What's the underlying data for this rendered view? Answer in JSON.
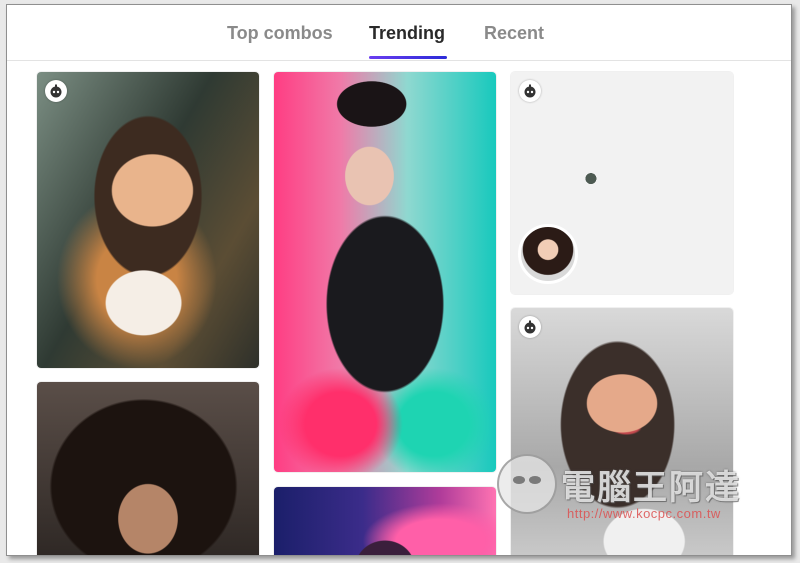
{
  "tabs": [
    {
      "label": "Top combos",
      "active": false
    },
    {
      "label": "Trending",
      "active": true
    },
    {
      "label": "Recent",
      "active": false
    }
  ],
  "accent_colors": {
    "tab_underline_start": "#6a3df0",
    "tab_underline_end": "#2b2bd8"
  },
  "gallery": {
    "cards": [
      {
        "style": "painted-portrait-woman",
        "badge_icon": "combo-face-icon",
        "has_badge": true
      },
      {
        "style": "neon-jacket-portrait",
        "has_badge": false
      },
      {
        "style": "3d-cartoon-face",
        "badge_icon": "combo-face-icon",
        "has_badge": true,
        "has_source_thumbnail": true
      },
      {
        "style": "curly-hair-portrait",
        "has_badge": false
      },
      {
        "style": "colorful-portrait",
        "has_badge": false
      },
      {
        "style": "sketch-portrait-woman",
        "badge_icon": "combo-face-icon",
        "has_badge": true
      }
    ]
  },
  "watermark": {
    "title": "電腦王阿達",
    "url": "http://www.kocpc.com.tw"
  }
}
